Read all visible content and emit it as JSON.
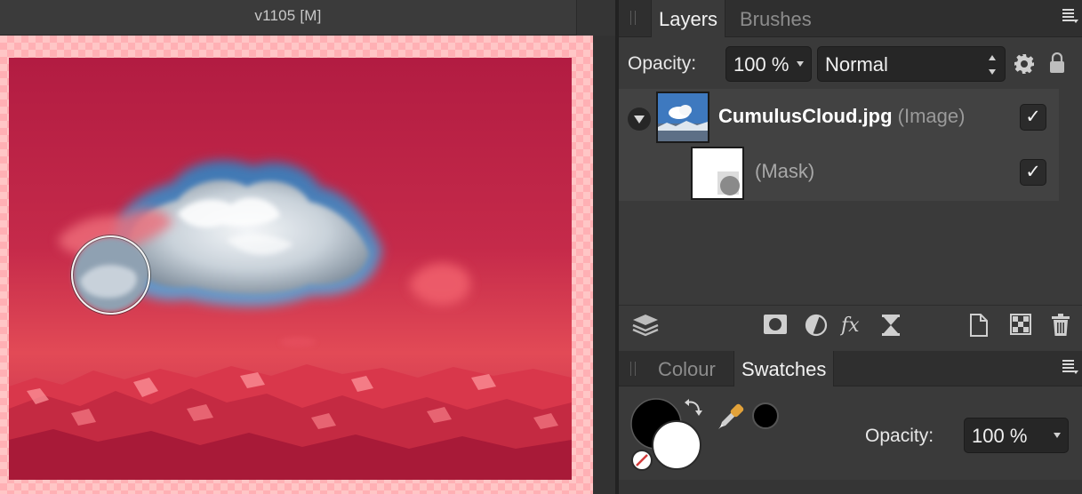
{
  "document": {
    "title": "v1105  [M]"
  },
  "layers_panel": {
    "tabs": [
      "Layers",
      "Brushes"
    ],
    "active_tab": "Layers",
    "opacity_label": "Opacity:",
    "opacity_value": "100 %",
    "blend_mode": "Normal",
    "layers": [
      {
        "name": "CumulusCloud.jpg",
        "type": "(Image)",
        "visible": "✓"
      },
      {
        "name": "(Mask)",
        "visible": "✓"
      }
    ],
    "toolbar_icons": [
      "layers-stack-icon",
      "mask-icon",
      "adjustment-icon",
      "fx-icon",
      "live-filter-icon",
      "new-layer-icon",
      "pixel-layer-icon",
      "trash-icon"
    ]
  },
  "swatches_panel": {
    "tabs": [
      "Colour",
      "Swatches"
    ],
    "active_tab": "Swatches",
    "opacity_label": "Opacity:",
    "opacity_value": "100 %",
    "primary_color": "#000000",
    "secondary_color": "#ffffff",
    "picked_color": "#000000"
  },
  "colors": {
    "canvas_tint": "#c52a4a",
    "panel_bg": "#3a3a3a"
  }
}
